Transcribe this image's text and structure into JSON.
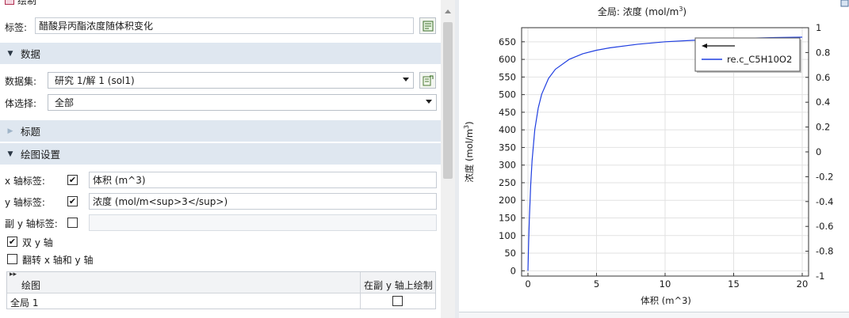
{
  "settings": {
    "top_cut_label": "绘制",
    "label_caption": "标签:",
    "label_value": "醋酸异丙酯浓度随体积变化",
    "sections": {
      "data": "数据",
      "title": "标题",
      "plot_settings": "绘图设置"
    },
    "dataset_caption": "数据集:",
    "dataset_value": "研究 1/解 1 (sol1)",
    "selection_caption": "体选择:",
    "selection_value": "全部",
    "x_axis_caption": "x 轴标签:",
    "x_axis_checked": true,
    "x_axis_value": "体积 (m^3)",
    "y_axis_caption": "y 轴标签:",
    "y_axis_checked": true,
    "y_axis_value": "浓度 (mol/m<sup>3</sup>)",
    "secondary_y_caption": "副 y 轴标签:",
    "secondary_y_checked": false,
    "secondary_y_value": "",
    "dual_y_label": "双 y 轴",
    "dual_y_checked": true,
    "flip_label": "翻转 x 轴和 y 轴",
    "flip_checked": false,
    "table": {
      "col_plot": "绘图",
      "col_secondary": "在副 y 轴上绘制",
      "rows": [
        {
          "plot": "全局 1",
          "secondary": false
        }
      ]
    }
  },
  "chart_data": {
    "type": "line",
    "title": "全局: 浓度 (mol/m³)",
    "title_prefix": "全局: 浓度 (mol/m",
    "title_sup": "3",
    "title_suffix": ")",
    "xlabel": "体积 (m^3)",
    "ylabel": "浓度 (mol/m³)",
    "ylabel_prefix": "浓度 (mol/m",
    "ylabel_sup": "3",
    "ylabel_suffix": ")",
    "xlim": [
      0,
      20
    ],
    "ylim": [
      -15,
      690
    ],
    "x_ticks": [
      0,
      5,
      10,
      15,
      20
    ],
    "y_ticks": [
      0,
      50,
      100,
      150,
      200,
      250,
      300,
      350,
      400,
      450,
      500,
      550,
      600,
      650
    ],
    "y2lim": [
      -1.0,
      1.0
    ],
    "y2_ticks": [
      "1",
      "0.8",
      "0.6",
      "0.4",
      "0.2",
      "0",
      "-0.2",
      "-0.4",
      "-0.6",
      "-0.8",
      "-1"
    ],
    "grid": true,
    "legend_position": "top-right",
    "series": [
      {
        "name": "re.c_C5H10O2",
        "color": "#1f3ee0",
        "x": [
          0,
          0.05,
          0.1,
          0.2,
          0.3,
          0.5,
          0.75,
          1.0,
          1.5,
          2.0,
          3.0,
          4.0,
          5.0,
          6.0,
          8.0,
          10.0,
          12.0,
          14.0,
          16.0,
          18.0,
          20.0
        ],
        "y": [
          0,
          80,
          145,
          243,
          312,
          401,
          462,
          501,
          546,
          572,
          600,
          616,
          626,
          633,
          643,
          650,
          654,
          657,
          660,
          662,
          663
        ]
      }
    ]
  }
}
